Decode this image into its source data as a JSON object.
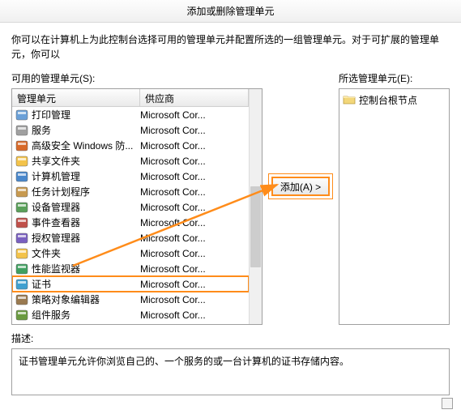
{
  "title": "添加或删除管理单元",
  "instructions": "你可以在计算机上为此控制台选择可用的管理单元并配置所选的一组管理单元。对于可扩展的管理单元，你可以",
  "available_label": "可用的管理单元(S):",
  "selected_label": "所选管理单元(E):",
  "header_name": "管理单元",
  "header_vendor": "供应商",
  "vendor": "Microsoft Cor...",
  "rows": [
    {
      "name": "打印管理",
      "icon": "printer"
    },
    {
      "name": "服务",
      "icon": "gear"
    },
    {
      "name": "高级安全 Windows 防...",
      "icon": "firewall"
    },
    {
      "name": "共享文件夹",
      "icon": "folder-share"
    },
    {
      "name": "计算机管理",
      "icon": "computer"
    },
    {
      "name": "任务计划程序",
      "icon": "clock"
    },
    {
      "name": "设备管理器",
      "icon": "device"
    },
    {
      "name": "事件查看器",
      "icon": "event"
    },
    {
      "name": "授权管理器",
      "icon": "auth"
    },
    {
      "name": "文件夹",
      "icon": "folder"
    },
    {
      "name": "性能监视器",
      "icon": "perf"
    },
    {
      "name": "证书",
      "icon": "cert",
      "selected": true,
      "highlight": true
    },
    {
      "name": "策略对象编辑器",
      "icon": "policy"
    },
    {
      "name": "组件服务",
      "icon": "component"
    }
  ],
  "add_button": "添加(A) >",
  "tree_root": "控制台根节点",
  "desc_label": "描述:",
  "desc_text": "证书管理单元允许你浏览自己的、一个服务的或一台计算机的证书存储内容。",
  "annotation": {
    "highlight_color": "#ff8c1a"
  }
}
